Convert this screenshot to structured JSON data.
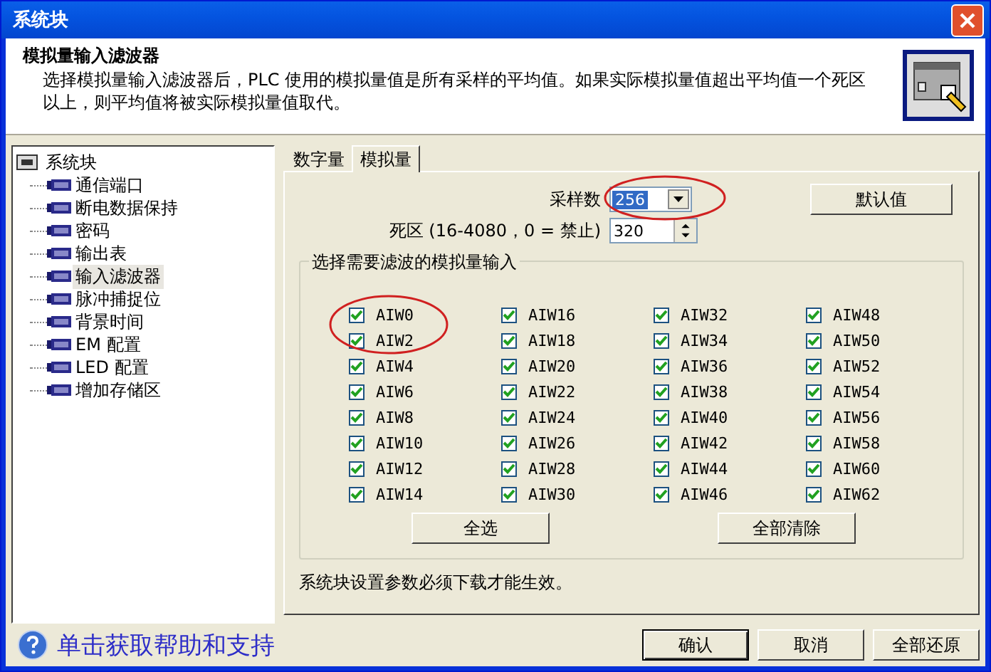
{
  "window": {
    "title": "系统块"
  },
  "header": {
    "title": "模拟量输入滤波器",
    "description": "选择模拟量输入滤波器后，PLC 使用的模拟量值是所有采样的平均值。如果实际模拟量值超出平均值一个死区以上，则平均值将被实际模拟量值取代。"
  },
  "tree": {
    "label": "系统块",
    "expanded": true,
    "children": [
      {
        "label": "通信端口",
        "selected": false
      },
      {
        "label": "断电数据保持",
        "selected": false
      },
      {
        "label": "密码",
        "selected": false
      },
      {
        "label": "输出表",
        "selected": false
      },
      {
        "label": "输入滤波器",
        "selected": true
      },
      {
        "label": "脉冲捕捉位",
        "selected": false
      },
      {
        "label": "背景时间",
        "selected": false
      },
      {
        "label": "EM 配置",
        "selected": false
      },
      {
        "label": "LED 配置",
        "selected": false
      },
      {
        "label": "增加存储区",
        "selected": false
      }
    ]
  },
  "tabs": [
    {
      "label": "数字量",
      "selected": false
    },
    {
      "label": "模拟量",
      "selected": true
    }
  ],
  "sample_count": {
    "label": "采样数",
    "value": "256",
    "circled": true
  },
  "default_button": "默认值",
  "dead_zone": {
    "label": "死区 (16-4080，0 = 禁止)",
    "value": "320"
  },
  "input_group": {
    "title": "选择需要滤波的模拟量输入",
    "inputs": [
      {
        "label": "AIW0",
        "checked": true,
        "circled": true
      },
      {
        "label": "AIW2",
        "checked": true,
        "circled": true
      },
      {
        "label": "AIW4",
        "checked": true
      },
      {
        "label": "AIW6",
        "checked": true
      },
      {
        "label": "AIW8",
        "checked": true
      },
      {
        "label": "AIW10",
        "checked": true
      },
      {
        "label": "AIW12",
        "checked": true
      },
      {
        "label": "AIW14",
        "checked": true
      },
      {
        "label": "AIW16",
        "checked": true
      },
      {
        "label": "AIW18",
        "checked": true
      },
      {
        "label": "AIW20",
        "checked": true
      },
      {
        "label": "AIW22",
        "checked": true
      },
      {
        "label": "AIW24",
        "checked": true
      },
      {
        "label": "AIW26",
        "checked": true
      },
      {
        "label": "AIW28",
        "checked": true
      },
      {
        "label": "AIW30",
        "checked": true
      },
      {
        "label": "AIW32",
        "checked": true
      },
      {
        "label": "AIW34",
        "checked": true
      },
      {
        "label": "AIW36",
        "checked": true
      },
      {
        "label": "AIW38",
        "checked": true
      },
      {
        "label": "AIW40",
        "checked": true
      },
      {
        "label": "AIW42",
        "checked": true
      },
      {
        "label": "AIW44",
        "checked": true
      },
      {
        "label": "AIW46",
        "checked": true
      },
      {
        "label": "AIW48",
        "checked": true
      },
      {
        "label": "AIW50",
        "checked": true
      },
      {
        "label": "AIW52",
        "checked": true
      },
      {
        "label": "AIW54",
        "checked": true
      },
      {
        "label": "AIW56",
        "checked": true
      },
      {
        "label": "AIW58",
        "checked": true
      },
      {
        "label": "AIW60",
        "checked": true
      },
      {
        "label": "AIW62",
        "checked": true
      }
    ],
    "buttons": [
      "全选",
      "全部清除"
    ]
  },
  "note": "系统块设置参数必须下载才能生效。",
  "help_link": "单击获取帮助和支持",
  "footer_buttons": [
    {
      "label": "确认",
      "default": true
    },
    {
      "label": "取消",
      "default": false
    },
    {
      "label": "全部还原",
      "default": false
    }
  ]
}
